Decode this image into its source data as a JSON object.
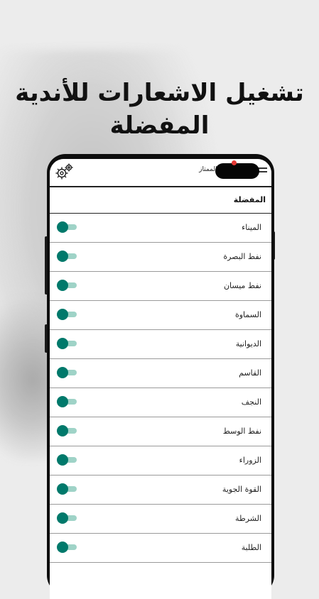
{
  "headline": "تشغيل الاشعارات للأندية المفضلة",
  "app": {
    "title": "في العراقي الممتاز",
    "section_title": "المفضلة"
  },
  "clubs": [
    {
      "label": "الميناء",
      "enabled": true
    },
    {
      "label": "نفط البصرة",
      "enabled": true
    },
    {
      "label": "نفط ميسان",
      "enabled": true
    },
    {
      "label": "السماوة",
      "enabled": true
    },
    {
      "label": "الديوانية",
      "enabled": true
    },
    {
      "label": "القاسم",
      "enabled": true
    },
    {
      "label": "النجف",
      "enabled": true
    },
    {
      "label": "نفط الوسط",
      "enabled": true
    },
    {
      "label": "الزوراء",
      "enabled": true
    },
    {
      "label": "القوة الجوية",
      "enabled": true
    },
    {
      "label": "الشرطة",
      "enabled": true
    },
    {
      "label": "الطلبة",
      "enabled": true
    }
  ],
  "icons": {
    "settings": "gears-icon",
    "menu": "hamburger-icon"
  },
  "colors": {
    "toggle_thumb": "#00796b",
    "toggle_track": "#9fd3c7",
    "camera_dot": "#e53935"
  }
}
